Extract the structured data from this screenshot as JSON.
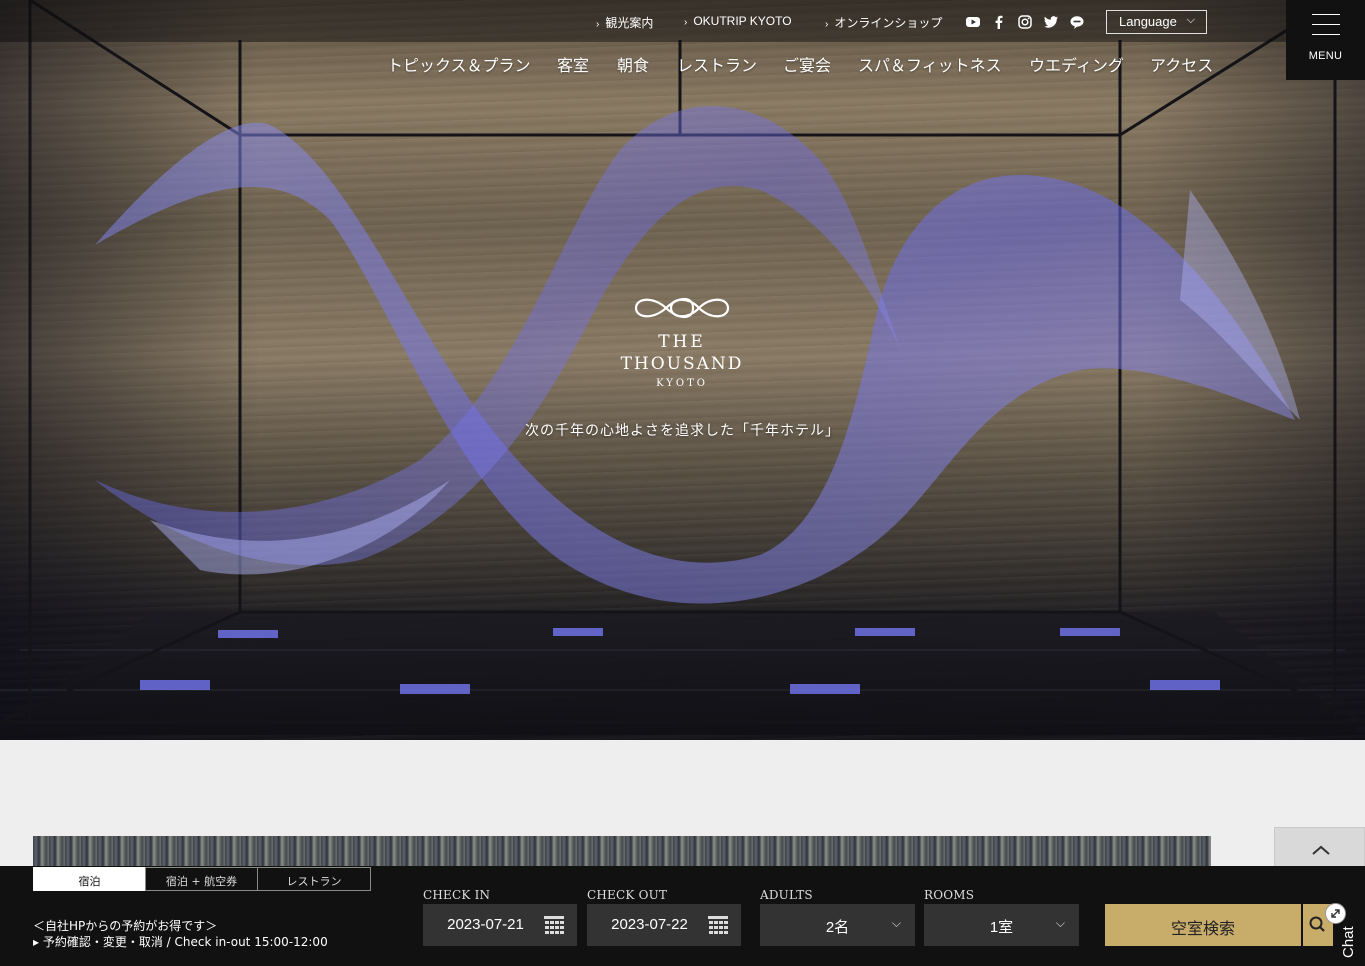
{
  "utility_links": [
    {
      "label": "観光案内"
    },
    {
      "label": "OKUTRIP KYOTO"
    },
    {
      "label": "オンラインショップ"
    }
  ],
  "social_icons": [
    "youtube-icon",
    "facebook-icon",
    "instagram-icon",
    "twitter-icon",
    "line-icon"
  ],
  "language": {
    "label": "Language"
  },
  "menu": {
    "label": "MENU"
  },
  "nav": [
    {
      "label": "トピックス＆プラン"
    },
    {
      "label": "客室"
    },
    {
      "label": "朝食"
    },
    {
      "label": "レストラン"
    },
    {
      "label": "ご宴会"
    },
    {
      "label": "スパ＆フィットネス"
    },
    {
      "label": "ウエディング"
    },
    {
      "label": "アクセス"
    }
  ],
  "logo": {
    "line1": "THE",
    "line2": "THOUSAND",
    "line3": "KYOTO"
  },
  "hero": {
    "tagline": "次の千年の心地よさを追求した「千年ホテル」"
  },
  "booking": {
    "tabs": [
      {
        "label": "宿泊",
        "active": true
      },
      {
        "label": "宿泊 + 航空券",
        "active": false
      },
      {
        "label": "レストラン",
        "active": false
      }
    ],
    "note_line1": "＜自社HPからの予約がお得です＞",
    "note_line2": "予約確認・変更・取消 / Check in-out 15:00-12:00",
    "check_in": {
      "label": "CHECK IN",
      "value": "2023-07-21"
    },
    "check_out": {
      "label": "CHECK OUT",
      "value": "2023-07-22"
    },
    "adults": {
      "label": "ADULTS",
      "value": "2名"
    },
    "rooms": {
      "label": "ROOMS",
      "value": "1室"
    },
    "search_label": "空室検索"
  },
  "chat": {
    "label": "Chat"
  },
  "colors": {
    "accent_gold": "#c8ac6a",
    "booking_bg": "#111111",
    "field_bg": "#333333"
  }
}
